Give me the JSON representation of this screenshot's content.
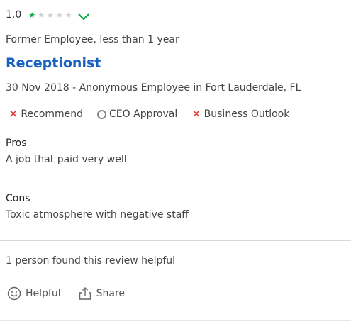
{
  "review": {
    "rating": "1.0",
    "stars": {
      "filled": 1,
      "total": 5
    },
    "employee_status": "Former Employee, less than 1 year",
    "title": "Receptionist",
    "meta": "30 Nov 2018 - Anonymous Employee in Fort Lauderdale, FL",
    "outlook": [
      {
        "label": "Recommend",
        "state": "negative"
      },
      {
        "label": "CEO Approval",
        "state": "neutral"
      },
      {
        "label": "Business Outlook",
        "state": "negative"
      }
    ],
    "pros_label": "Pros",
    "pros_text": "A job that paid very well",
    "cons_label": "Cons",
    "cons_text": "Toxic atmosphere with negative staff",
    "helpful_count_text": "1 person found this review helpful",
    "actions": {
      "helpful_label": "Helpful",
      "share_label": "Share"
    }
  },
  "colors": {
    "star_filled": "#0caa41",
    "title_link": "#1861bf",
    "negative": "#e52f2f",
    "chevron": "#0caa41"
  },
  "icons": [
    "star-icon",
    "chevron-down-icon",
    "x-icon",
    "circle-icon",
    "smiley-icon",
    "share-icon"
  ]
}
